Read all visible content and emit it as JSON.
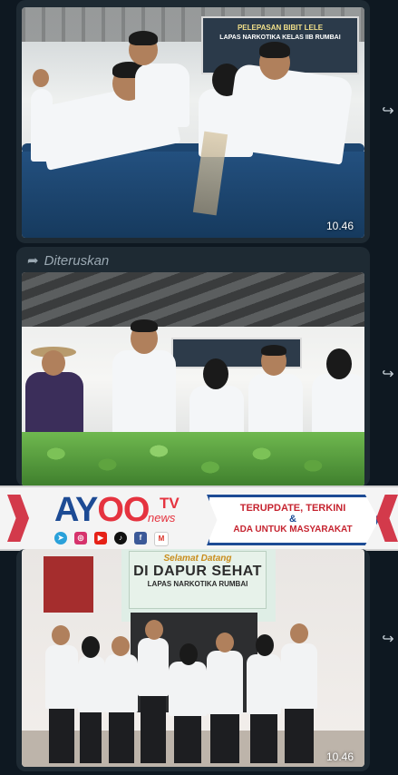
{
  "messages": [
    {
      "time": "10.46",
      "forwarded": false
    },
    {
      "forwarded_label": "Diteruskan"
    },
    {
      "time": "10.46"
    }
  ],
  "photo1": {
    "banner_line1": "PELEPASAN BIBIT LELE",
    "banner_line2": "LAPAS NARKOTIKA KELAS IIB RUMBAI"
  },
  "ad": {
    "logo_main": "AYOO",
    "logo_tv": "TV",
    "logo_news": "news",
    "slogan_line1": "TERUPDATE, TERKINI",
    "slogan_amp": "&",
    "slogan_line2": "ADA UNTUK MASYARAKAT",
    "socials": [
      "telegram-icon",
      "instagram-icon",
      "youtube-icon",
      "tiktok-icon",
      "facebook-icon",
      "gmail-icon"
    ],
    "colors": {
      "blue": "#1d4b94",
      "red": "#e5333f"
    }
  },
  "photo3": {
    "sign_line1": "Selamat Datang",
    "sign_line2": "DI DAPUR SEHAT",
    "sign_line3": "LAPAS NARKOTIKA RUMBAI"
  }
}
